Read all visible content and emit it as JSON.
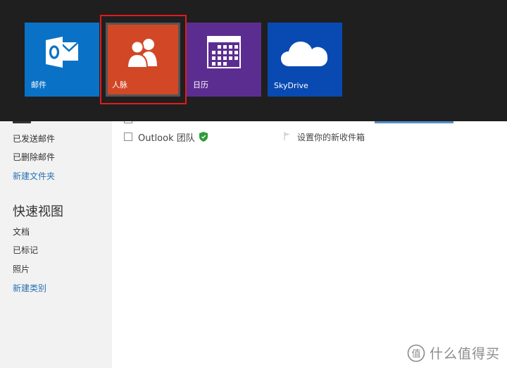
{
  "sidebar": {
    "items": [
      {
        "label": "已发送邮件",
        "is_link": false
      },
      {
        "label": "已删除邮件",
        "is_link": false
      },
      {
        "label": "新建文件夹",
        "is_link": true
      }
    ],
    "quick_views_heading": "快速视图",
    "quick_views": [
      {
        "label": "文档",
        "is_link": false
      },
      {
        "label": "已标记",
        "is_link": false
      },
      {
        "label": "照片",
        "is_link": false
      },
      {
        "label": "新建类别",
        "is_link": true
      }
    ]
  },
  "message": {
    "sender": "Outlook 团队",
    "subject": "设置你的新收件箱",
    "sender_icon": "shield-icon",
    "flag_icon": "flag-icon"
  },
  "flyout": {
    "tiles": [
      {
        "label": "邮件",
        "icon": "outlook-mail-icon",
        "color": "#0a72c6"
      },
      {
        "label": "人脉",
        "icon": "people-icon",
        "color": "#d24726",
        "selected": true
      },
      {
        "label": "日历",
        "icon": "calendar-icon",
        "color": "#5c2d91"
      },
      {
        "label": "SkyDrive",
        "icon": "cloud-icon",
        "color": "#094ab2"
      }
    ],
    "highlight_color": "#e11b1b"
  },
  "watermark": {
    "text": "什么值得买",
    "icon": "smzdm-logo-icon"
  }
}
